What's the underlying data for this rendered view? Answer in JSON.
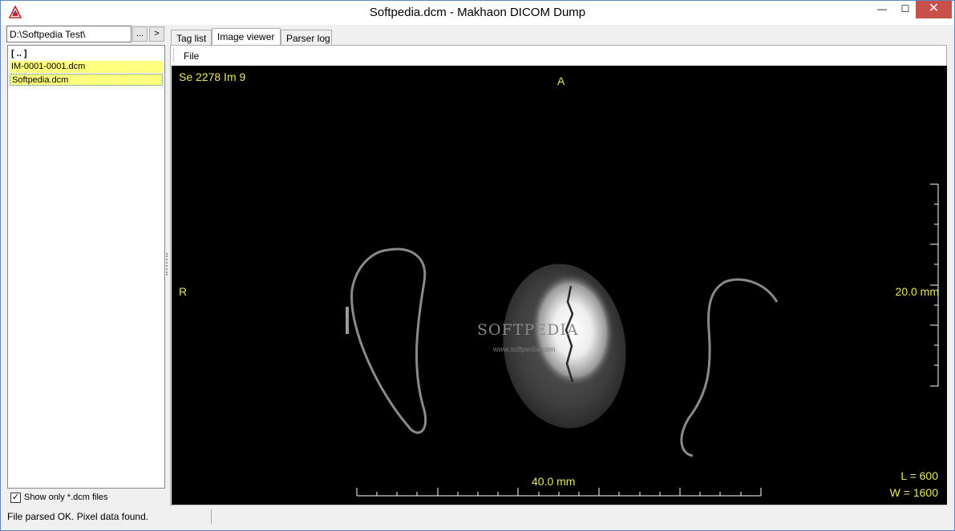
{
  "window": {
    "title": "Softpedia.dcm - Makhaon DICOM Dump",
    "minimize_glyph": "—",
    "maximize_glyph": "☐",
    "close_glyph": "✕"
  },
  "browser": {
    "path_value": "D:\\Softpedia Test\\",
    "browse_label": "...",
    "go_label": ">",
    "files": [
      "[ .. ]",
      "IM-0001-0001.dcm",
      "Softpedia.dcm"
    ],
    "selected_color": "#ffff80",
    "filter_checked": true,
    "filter_check_glyph": "✓",
    "filter_label": "Show only *.dcm files"
  },
  "tabs": [
    {
      "label": "Tag list",
      "active": false
    },
    {
      "label": "Image viewer",
      "active": true
    },
    {
      "label": "Parser log",
      "active": false
    }
  ],
  "menu": {
    "file_label": "File"
  },
  "viewer": {
    "series_label": "Se 2278 Im 9",
    "orientation_top": "A",
    "orientation_left": "R",
    "vertical_scale_label": "20.0 mm",
    "horizontal_scale_label": "40.0 mm",
    "level_label": "L = 600",
    "width_label": "W = 1600",
    "overlay_color": "#e8e860",
    "watermark": "SOFTPEDIA",
    "watermark_url": "www.softpedia.com"
  },
  "status": {
    "message": "File parsed OK. Pixel data found."
  }
}
